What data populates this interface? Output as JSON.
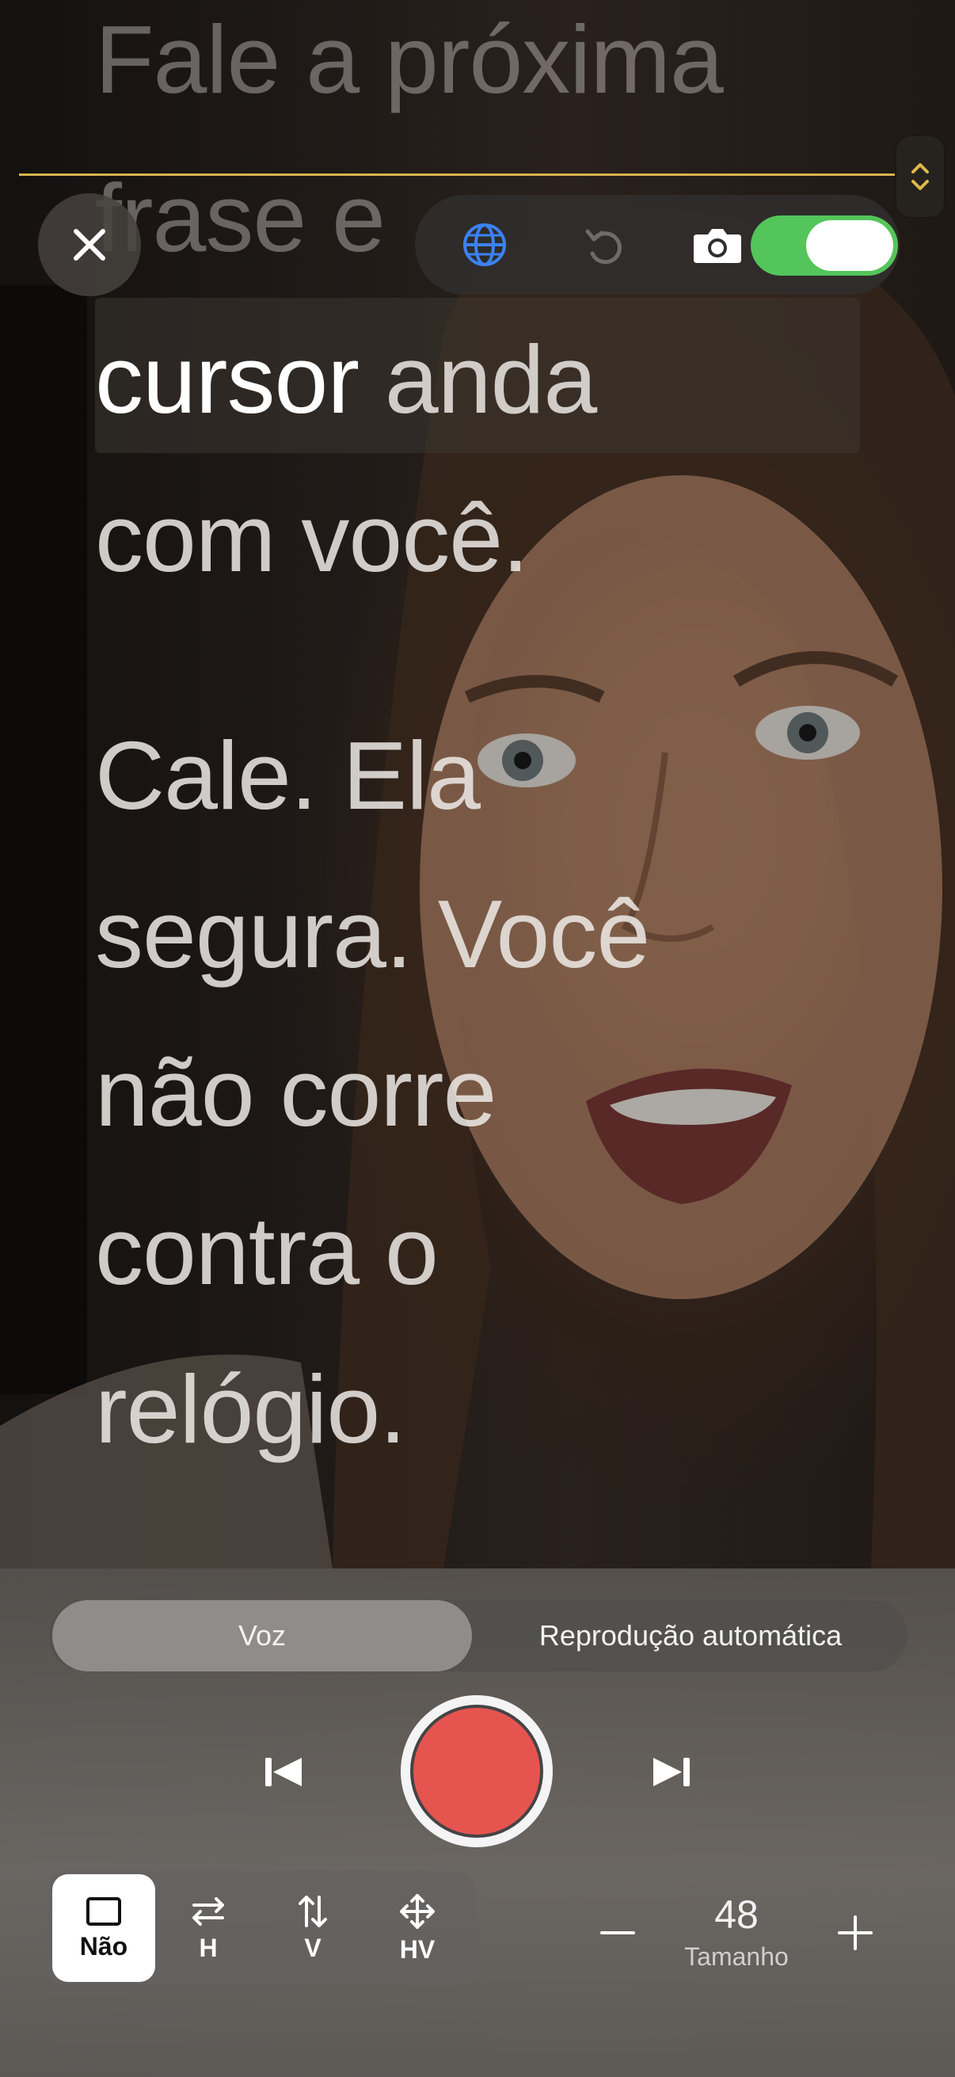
{
  "script": {
    "faded_lines": [
      "Fale a próxima",
      "frase e"
    ],
    "active_line": {
      "cursor_word": "cursor",
      "rest": " anda"
    },
    "following_lines": [
      "com você.",
      "Cale. Ela",
      "segura. Você",
      "não corre",
      "contra o",
      "relógio."
    ]
  },
  "toolbar": {
    "icons": [
      "close-icon",
      "globe-icon",
      "undo-icon",
      "camera-icon"
    ],
    "camera_toggle_on": true,
    "toggle_color": "#54c55a"
  },
  "mode_switch": {
    "options": [
      "Voz",
      "Reprodução automática"
    ],
    "selected": "Voz"
  },
  "controls": {
    "record_color": "#e65450"
  },
  "mirror": {
    "options": [
      {
        "label": "Não",
        "icon": "square-icon"
      },
      {
        "label": "H",
        "icon": "horizontal-arrows-icon"
      },
      {
        "label": "V",
        "icon": "vertical-arrows-icon"
      },
      {
        "label": "HV",
        "icon": "move-arrows-icon"
      }
    ],
    "selected": "Não"
  },
  "size": {
    "value": "48",
    "label": "Tamanho"
  },
  "colors": {
    "guide_line": "#d8b450",
    "accent_globe": "#3b82f6"
  }
}
